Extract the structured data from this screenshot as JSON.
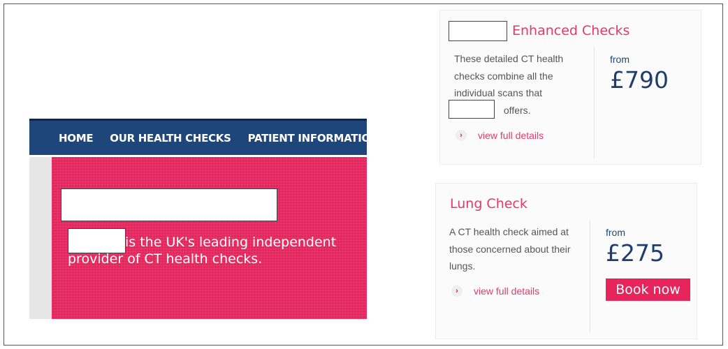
{
  "nav": {
    "items": [
      {
        "label": "HOME"
      },
      {
        "label": "OUR HEALTH CHECKS"
      },
      {
        "label": "PATIENT INFORMATION"
      }
    ]
  },
  "hero": {
    "text": "is the UK's leading independent provider of CT health checks."
  },
  "cards": [
    {
      "title": "Enhanced Checks",
      "description_part1": "These detailed CT health checks combine all the individual scans that",
      "description_part2": "offers.",
      "from_label": "from",
      "price": "£790",
      "link_label": "view full details"
    },
    {
      "title": "Lung Check",
      "description": "A CT health check aimed at those concerned about their lungs.",
      "from_label": "from",
      "price": "£275",
      "link_label": "view full details",
      "button_label": "Book now"
    }
  ],
  "colors": {
    "nav_bg": "#1e467a",
    "hero_bg": "#e8245c",
    "accent": "#e13a6b",
    "price": "#1e3d6d"
  }
}
